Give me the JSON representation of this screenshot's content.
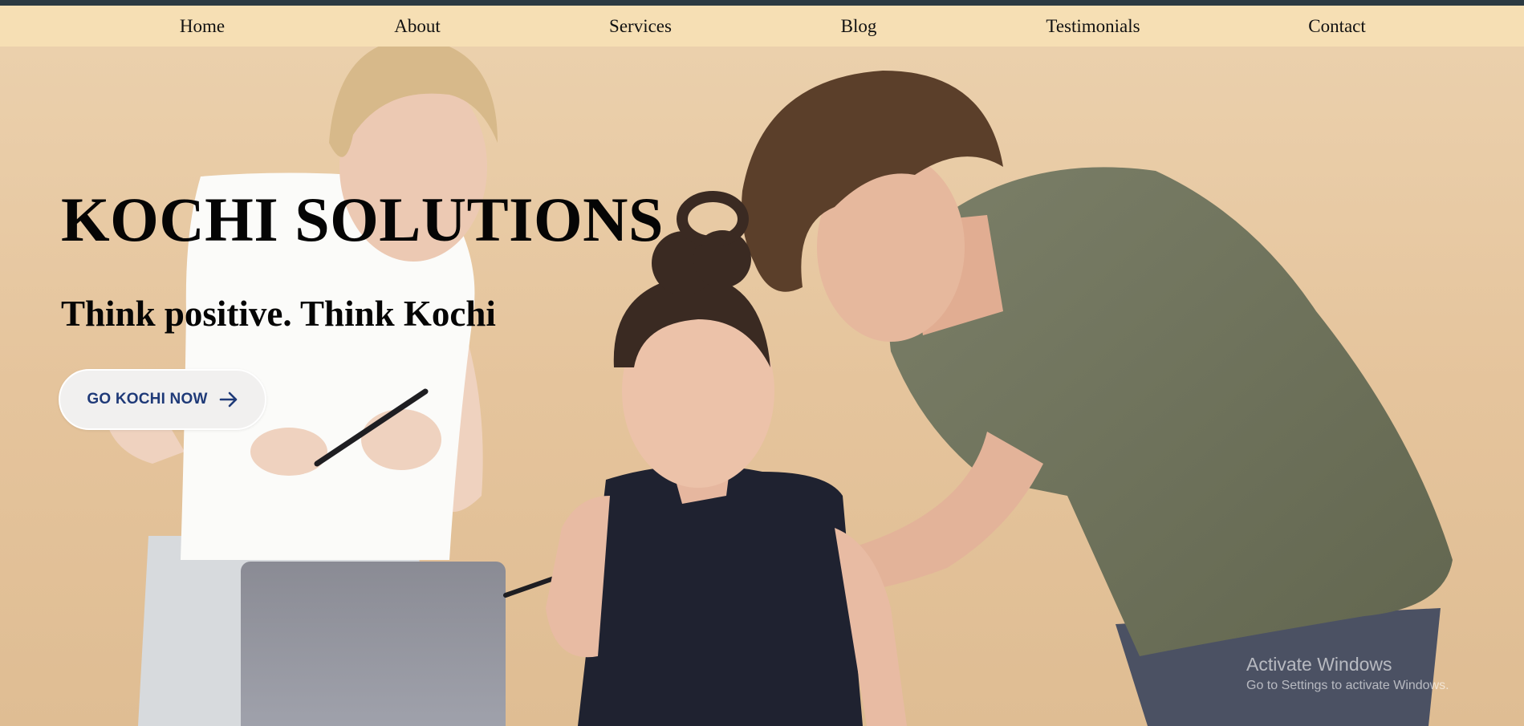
{
  "nav": {
    "items": [
      {
        "label": "Home"
      },
      {
        "label": "About"
      },
      {
        "label": "Services"
      },
      {
        "label": "Blog"
      },
      {
        "label": "Testimonials"
      },
      {
        "label": "Contact"
      }
    ]
  },
  "hero": {
    "title": "KOCHI SOLUTIONS",
    "tagline": "Think positive. Think Kochi",
    "cta_label": "GO KOCHI NOW",
    "cta_icon": "arrow-right-icon",
    "background_image": "team-working-photo"
  },
  "watermark": {
    "title": "Activate Windows",
    "subtitle": "Go to Settings to activate Windows."
  },
  "colors": {
    "nav_background": "#f6dfb4",
    "top_strip": "#2b3a42",
    "hero_background": "#e7c9a2",
    "cta_text": "#1f3a78",
    "cta_background": "#f1f0ef"
  }
}
